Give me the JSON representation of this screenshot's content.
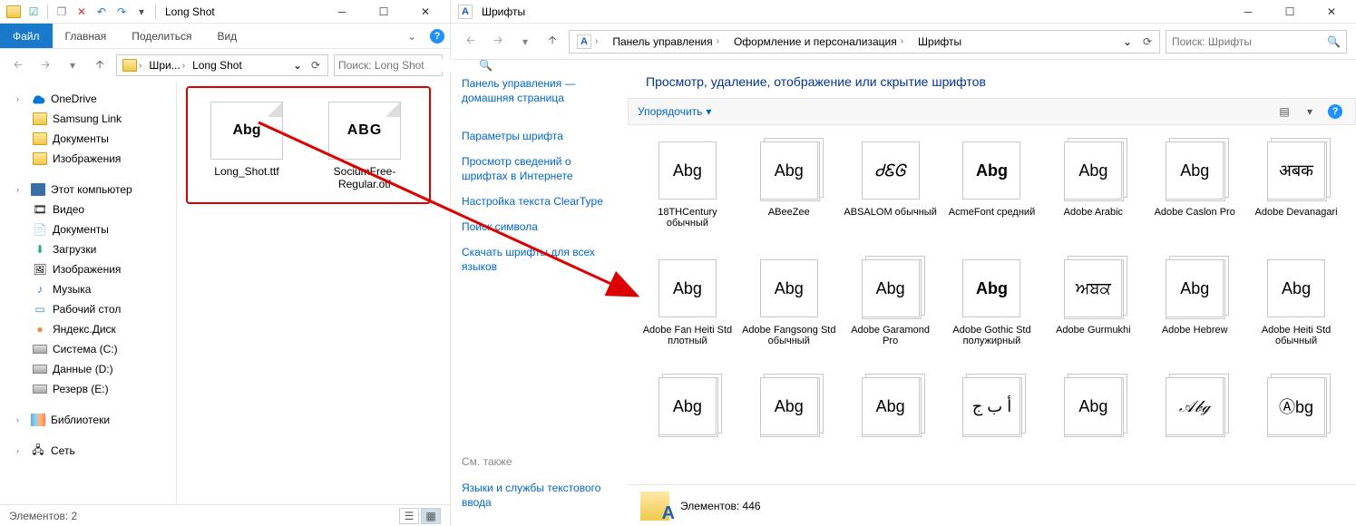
{
  "left": {
    "title": "Long Shot",
    "tabs": {
      "file": "Файл",
      "home": "Главная",
      "share": "Поделиться",
      "view": "Вид"
    },
    "path": [
      "Шри...",
      "Long Shot"
    ],
    "search_placeholder": "Поиск: Long Shot",
    "tree": {
      "onedrive": "OneDrive",
      "onedrive_children": [
        "Samsung Link",
        "Документы",
        "Изображения"
      ],
      "thispc": "Этот компьютер",
      "thispc_children": [
        "Видео",
        "Документы",
        "Загрузки",
        "Изображения",
        "Музыка",
        "Рабочий стол",
        "Яндекс.Диск",
        "Система (C:)",
        "Данные (D:)",
        "Резерв (E:)"
      ],
      "libraries": "Библиотеки",
      "network": "Сеть"
    },
    "files": [
      {
        "name": "Long_Shot.ttf",
        "preview": "Abg"
      },
      {
        "name": "SociumFree-Regular.otf",
        "preview": "ABG"
      }
    ],
    "status": "Элементов: 2"
  },
  "right": {
    "title": "Шрифты",
    "breadcrumb": [
      "Панель управления",
      "Оформление и персонализация",
      "Шрифты"
    ],
    "search_placeholder": "Поиск: Шрифты",
    "links": [
      "Панель управления — домашняя страница",
      "Параметры шрифта",
      "Просмотр сведений о шрифтах в Интернете",
      "Настройка текста ClearType",
      "Поиск символа",
      "Скачать шрифты для всех языков"
    ],
    "seealso": "См. также",
    "seealso_link": "Языки и службы текстового ввода",
    "heading": "Просмотр, удаление, отображение или скрытие шрифтов",
    "organize": "Упорядочить",
    "fonts": [
      {
        "name": "18THCentury обычный",
        "preview": "Abg",
        "stack": false
      },
      {
        "name": "ABeeZee",
        "preview": "Abg",
        "stack": true
      },
      {
        "name": "ABSALOM обычный",
        "preview": "ᏧᏋᎶ",
        "stack": false,
        "style": "font-style:italic"
      },
      {
        "name": "AcmeFont средний",
        "preview": "Abg",
        "stack": false,
        "style": "font-weight:900"
      },
      {
        "name": "Adobe Arabic",
        "preview": "Abg",
        "stack": true
      },
      {
        "name": "Adobe Caslon Pro",
        "preview": "Abg",
        "stack": true
      },
      {
        "name": "Adobe Devanagari",
        "preview": "अबक",
        "stack": true
      },
      {
        "name": "Adobe Fan Heiti Std плотный",
        "preview": "Abg",
        "stack": false
      },
      {
        "name": "Adobe Fangsong Std обычный",
        "preview": "Abg",
        "stack": false
      },
      {
        "name": "Adobe Garamond Pro",
        "preview": "Abg",
        "stack": true
      },
      {
        "name": "Adobe Gothic Std полужирный",
        "preview": "Abg",
        "stack": false,
        "style": "font-weight:900"
      },
      {
        "name": "Adobe Gurmukhi",
        "preview": "ਅਬਕ",
        "stack": true
      },
      {
        "name": "Adobe Hebrew",
        "preview": "Abg",
        "stack": true
      },
      {
        "name": "Adobe Heiti Std обычный",
        "preview": "Abg",
        "stack": false
      },
      {
        "name": "",
        "preview": "Abg",
        "stack": true
      },
      {
        "name": "",
        "preview": "Abg",
        "stack": true
      },
      {
        "name": "",
        "preview": "Abg",
        "stack": true
      },
      {
        "name": "",
        "preview": "أ ب ج",
        "stack": true
      },
      {
        "name": "",
        "preview": "Abg",
        "stack": true
      },
      {
        "name": "",
        "preview": "𝒜𝒷ℊ",
        "stack": true,
        "style": "font-style:italic"
      },
      {
        "name": "",
        "preview": "Ⓐbg",
        "stack": true
      }
    ],
    "status": "Элементов: 446"
  }
}
